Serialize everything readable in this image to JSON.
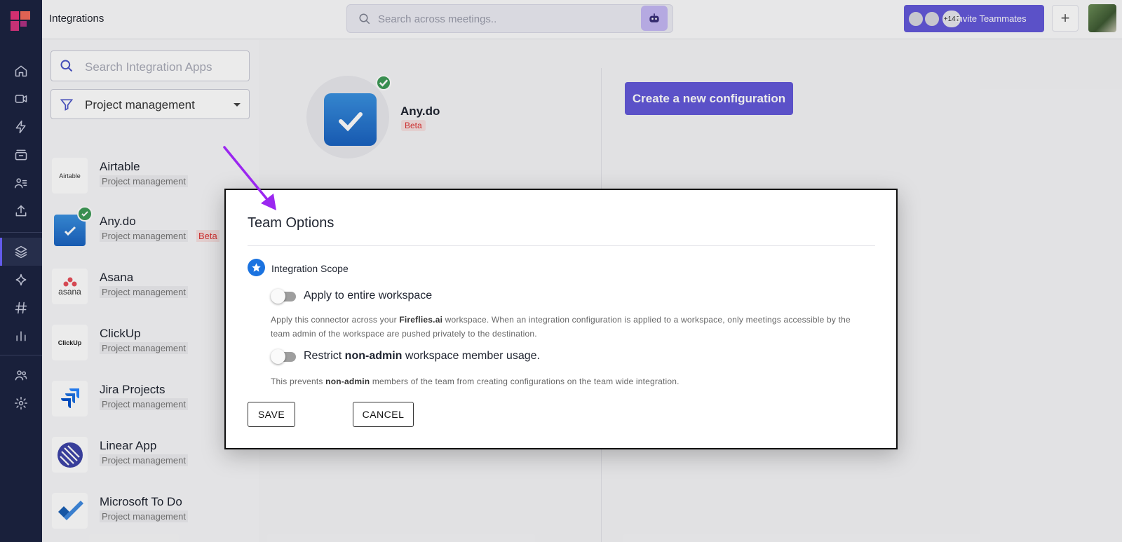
{
  "topbar": {
    "title": "Integrations",
    "search_placeholder": "Search across meetings..",
    "invite_more": "+149",
    "invite_label": "Invite Teammates",
    "plus_label": "+"
  },
  "panel": {
    "search_placeholder": "Search Integration Apps",
    "filter_value": "Project management",
    "apps": [
      {
        "name": "Airtable",
        "category": "Project management",
        "logo_text": "Airtable"
      },
      {
        "name": "Any.do",
        "category": "Project management",
        "badge": "Beta"
      },
      {
        "name": "Asana",
        "category": "Project management",
        "logo_text": "asana"
      },
      {
        "name": "ClickUp",
        "category": "Project management",
        "logo_text": "ClickUp"
      },
      {
        "name": "Jira Projects",
        "category": "Project management"
      },
      {
        "name": "Linear App",
        "category": "Project management"
      },
      {
        "name": "Microsoft To Do",
        "category": "Project management"
      }
    ]
  },
  "main": {
    "app_name": "Any.do",
    "app_badge": "Beta",
    "create_button": "Create a new configuration"
  },
  "dialog": {
    "title": "Team Options",
    "scope_label": "Integration Scope",
    "option1_label": "Apply to entire workspace",
    "option1_desc_pre": "Apply this connector across your ",
    "option1_desc_bold": "Fireflies.ai",
    "option1_desc_post": " workspace. When an integration configuration is applied to a workspace, only meetings accessible by the team admin of the workspace are pushed privately to the destination.",
    "option1_enabled": false,
    "option2_pre": "Restrict ",
    "option2_bold": "non-admin",
    "option2_post": " workspace member usage.",
    "option2_enabled": false,
    "option2_desc_pre": "This prevents ",
    "option2_desc_bold": "non-admin",
    "option2_desc_post": " members of the team from creating configurations on the team wide integration.",
    "save_label": "SAVE",
    "cancel_label": "CANCEL"
  },
  "colors": {
    "rail": "#1c2340",
    "accent": "#6358d9",
    "check": "#3e9b57",
    "annotation_arrow": "#9b27f0"
  }
}
